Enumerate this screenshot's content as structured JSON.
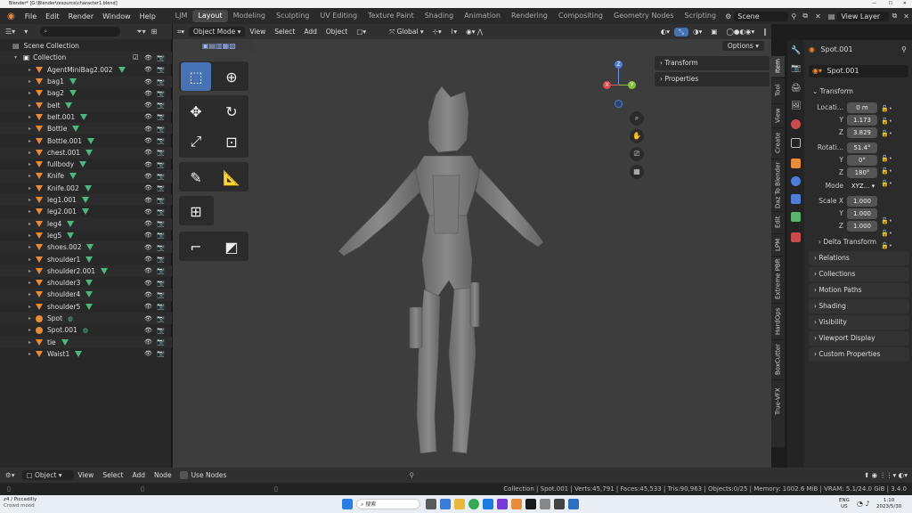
{
  "titlebar": {
    "title": "Blender* [G:\\Blender\\resource\\character1.blend]"
  },
  "menu": [
    "File",
    "Edit",
    "Render",
    "Window",
    "Help"
  ],
  "workspaces": [
    "LJM",
    "Layout",
    "Modeling",
    "Sculpting",
    "UV Editing",
    "Texture Paint",
    "Shading",
    "Animation",
    "Rendering",
    "Compositing",
    "Geometry Nodes",
    "Scripting"
  ],
  "active_workspace": "Layout",
  "scene": "Scene",
  "view_layer": "View Layer",
  "outliner": {
    "scene_collection": "Scene Collection",
    "collection": "Collection",
    "items": [
      {
        "name": "AgentMiniBag2.002",
        "kind": "mesh"
      },
      {
        "name": "bag1",
        "kind": "mesh"
      },
      {
        "name": "bag2",
        "kind": "mesh"
      },
      {
        "name": "belt",
        "kind": "mesh"
      },
      {
        "name": "belt.001",
        "kind": "mesh"
      },
      {
        "name": "Bottle",
        "kind": "mesh"
      },
      {
        "name": "Bottle.001",
        "kind": "mesh"
      },
      {
        "name": "chest.001",
        "kind": "mesh"
      },
      {
        "name": "fullbody",
        "kind": "mesh"
      },
      {
        "name": "Knife",
        "kind": "mesh"
      },
      {
        "name": "Knife.002",
        "kind": "mesh"
      },
      {
        "name": "leg1.001",
        "kind": "mesh"
      },
      {
        "name": "leg2.001",
        "kind": "mesh"
      },
      {
        "name": "leg4",
        "kind": "mesh"
      },
      {
        "name": "leg5",
        "kind": "mesh"
      },
      {
        "name": "shoes.002",
        "kind": "mesh"
      },
      {
        "name": "shoulder1",
        "kind": "mesh"
      },
      {
        "name": "shoulder2.001",
        "kind": "mesh"
      },
      {
        "name": "shoulder3",
        "kind": "mesh"
      },
      {
        "name": "shoulder4",
        "kind": "mesh"
      },
      {
        "name": "shoulder5",
        "kind": "mesh"
      },
      {
        "name": "Spot",
        "kind": "light"
      },
      {
        "name": "Spot.001",
        "kind": "light"
      },
      {
        "name": "tie",
        "kind": "mesh"
      },
      {
        "name": "Waist1",
        "kind": "mesh"
      }
    ]
  },
  "viewport": {
    "mode": "Object Mode",
    "menus": [
      "View",
      "Select",
      "Add",
      "Object"
    ],
    "orientation": "Global",
    "options": "Options",
    "npanel": [
      "Transform",
      "Properties"
    ],
    "vtabs": [
      "Item",
      "Tool",
      "View",
      "Create",
      "Daz To Blender",
      "Edit",
      "LPM",
      "Extreme PBR",
      "HardOps",
      "BoxCutter",
      "True-VFX"
    ]
  },
  "properties": {
    "object": "Spot.001",
    "data": "Spot.001",
    "transform_label": "Transform",
    "location_label": "Locati...",
    "location": [
      "0 m",
      "1.173",
      "3.829"
    ],
    "rotation_label": "Rotati...",
    "rotation": [
      "51.4°",
      "0°",
      "180°"
    ],
    "mode_label": "Mode",
    "mode": "XYZ...",
    "scale_label": "Scale X",
    "scale": [
      "1.000",
      "1.000",
      "1.000"
    ],
    "axes": [
      "X",
      "Y",
      "Z"
    ],
    "delta": "Delta Transform",
    "sections": [
      "Relations",
      "Collections",
      "Motion Paths",
      "Shading",
      "Visibility",
      "Viewport Display",
      "Custom Properties"
    ]
  },
  "bottom": {
    "editor": "Object",
    "menus": [
      "View",
      "Select",
      "Add",
      "Node"
    ],
    "use_nodes": "Use Nodes"
  },
  "status": "Collection | Spot.001 | Verts:45,791 | Faces:45,533 | Tris:90,963 | Objects:0/25 | Memory: 1002.6 MiB | VRAM: 5.1/24.0 GiB | 3.4.0",
  "taskbar": {
    "notice_title": "z4 / Piccadilly",
    "notice_sub": "Crowd mood",
    "search": "搜索",
    "lang1": "ENG",
    "lang2": "US",
    "time": "1:10",
    "date": "2023/5/30"
  }
}
